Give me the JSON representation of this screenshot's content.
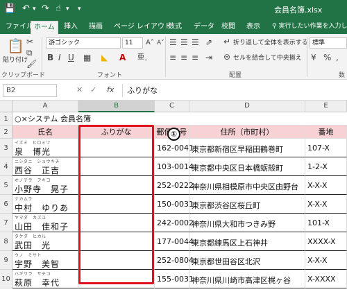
{
  "window": {
    "title": "会員名簿.xlsx"
  },
  "tabs": [
    "ファイル",
    "ホーム",
    "挿入",
    "描画",
    "ページ レイアウト",
    "数式",
    "データ",
    "校閲",
    "表示"
  ],
  "tell_me": "実行したい作業を入力してくだ",
  "ribbon": {
    "paste_label": "貼り付け",
    "font_name": "游ゴシック",
    "font_size": "11",
    "bold": "B",
    "italic": "I",
    "underline": "U",
    "wrap_text": "折り返して全体を表示する",
    "merge_center": "セルを結合して中央揃え",
    "number_format": "標準",
    "groups": {
      "clipboard": "クリップボード",
      "font": "フォント",
      "alignment": "配置",
      "number": "数"
    }
  },
  "formula_bar": {
    "name_box": "B2",
    "fx": "fx",
    "formula": "ふりがな"
  },
  "columns": [
    "A",
    "B",
    "C",
    "D",
    "E"
  ],
  "rows": [
    "1",
    "2",
    "3",
    "4",
    "5",
    "6",
    "7",
    "8",
    "9",
    "10"
  ],
  "sheet": {
    "title": "○×システム 会員名簿",
    "headers": [
      "氏名",
      "ふりがな",
      "郵便番号",
      "住所（市町村）",
      "番地"
    ],
    "records": [
      {
        "ruby": "イズミ　ヒロミツ",
        "name": "泉　博光",
        "zip": "162-0041",
        "address": "東京都新宿区早稲田鶴巻町",
        "banchi": "107-X"
      },
      {
        "ruby": "ニシタニ　ショウキチ",
        "name": "西谷　正吉",
        "zip": "103-0014",
        "address": "東京都中央区日本橋蛎殻町",
        "banchi": "1-2-X"
      },
      {
        "ruby": "オノデラ　アキコ",
        "name": "小野寺　晃子",
        "zip": "252-0222",
        "address": "神奈川県相模原市中央区由野台",
        "banchi": "X-X-X"
      },
      {
        "ruby": "ナカムラ",
        "name": "中村　ゆりあ",
        "zip": "150-0031",
        "address": "東京都渋谷区桜丘町",
        "banchi": "X-X-X"
      },
      {
        "ruby": "ヤマダ　カズコ",
        "name": "山田　佳和子",
        "zip": "242-0002",
        "address": "神奈川県大和市つきみ野",
        "banchi": "101-X"
      },
      {
        "ruby": "タケダ　ヒカル",
        "name": "武田　光",
        "zip": "177-0044",
        "address": "東京都練馬区上石神井",
        "banchi": "XXXX-X"
      },
      {
        "ruby": "ウノ　ミサト",
        "name": "宇野　美智",
        "zip": "252-0804",
        "address": "東京都世田谷区北沢",
        "banchi": "X-X-X"
      },
      {
        "ruby": "ハギワラ　サチコ",
        "name": "萩原　幸代",
        "zip": "155-0031",
        "address": "神奈川県川崎市高津区梶ヶ谷",
        "banchi": "X-XXXX"
      }
    ]
  },
  "callout": "①",
  "colors": {
    "excel_green": "#217346",
    "header_fill": "#f7d1d4",
    "highlight": "#e2101d"
  }
}
